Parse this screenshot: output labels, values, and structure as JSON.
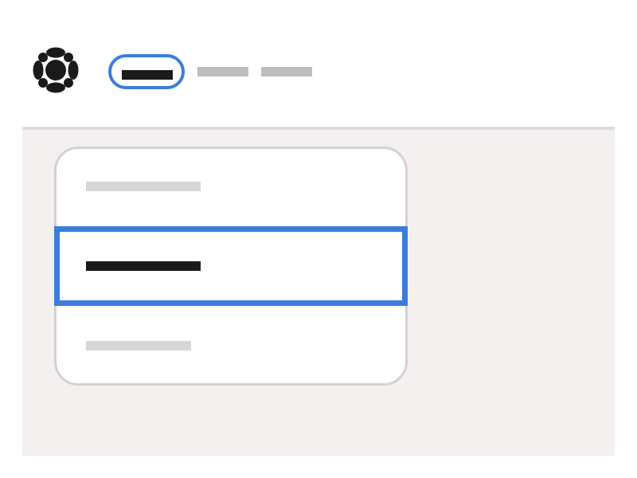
{
  "colors": {
    "page_background": "#ffffff",
    "content_background": "#f4f0ef",
    "divider": "#dcdcdc",
    "focus_accent": "#3b7ddd",
    "text_active": "#1a1a1a",
    "text_inactive_nav": "#bdbdbd",
    "text_inactive_menu": "#d8d6d5",
    "menu_border": "#d4d2d0"
  },
  "header": {
    "logo_icon": "gem-logo-icon",
    "nav": {
      "tabs": [
        {
          "state": "focused"
        },
        {
          "state": "inactive"
        },
        {
          "state": "inactive"
        }
      ]
    }
  },
  "dropdown": {
    "items": [
      {
        "state": "inactive"
      },
      {
        "state": "focused"
      },
      {
        "state": "inactive"
      }
    ]
  }
}
